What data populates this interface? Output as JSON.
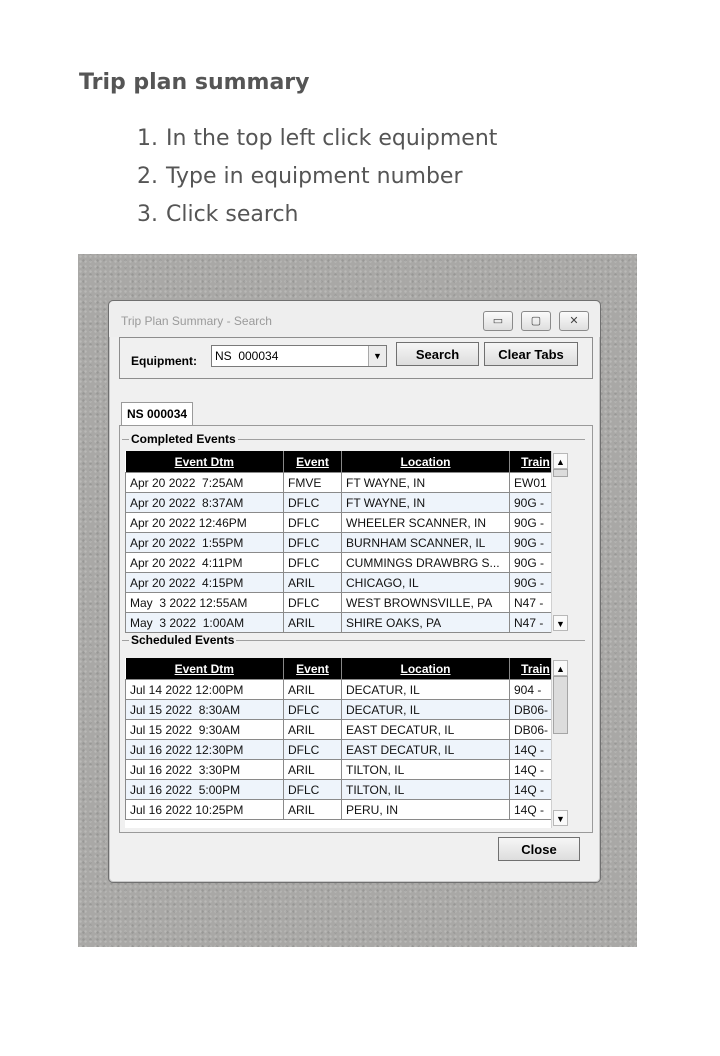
{
  "doc": {
    "heading": "Trip plan summary",
    "steps": [
      {
        "num": "1.",
        "text": "In the top left click equipment"
      },
      {
        "num": "2.",
        "text": "Type in equipment number"
      },
      {
        "num": "3.",
        "text": "Click search"
      }
    ]
  },
  "window": {
    "title": "Trip Plan Summary - Search",
    "minimize_glyph": "▭",
    "maximize_glyph": "▢",
    "close_glyph": "✕"
  },
  "search": {
    "label": "Equipment:",
    "value": "NS  000034",
    "dropdown_glyph": "▼",
    "search_label": "Search",
    "clear_tabs_label": "Clear Tabs"
  },
  "tab": {
    "label": "NS 000034"
  },
  "completed": {
    "group_label": "Completed Events",
    "columns": [
      "Event Dtm",
      "Event",
      "Location",
      "Train"
    ],
    "rows": [
      [
        "Apr 20 2022  7:25AM",
        "FMVE",
        "FT WAYNE, IN",
        "EW01"
      ],
      [
        "Apr 20 2022  8:37AM",
        "DFLC",
        "FT WAYNE, IN",
        "90G -"
      ],
      [
        "Apr 20 2022 12:46PM",
        "DFLC",
        "WHEELER SCANNER, IN",
        "90G -"
      ],
      [
        "Apr 20 2022  1:55PM",
        "DFLC",
        "BURNHAM SCANNER, IL",
        "90G -"
      ],
      [
        "Apr 20 2022  4:11PM",
        "DFLC",
        "CUMMINGS DRAWBRG S...",
        "90G -"
      ],
      [
        "Apr 20 2022  4:15PM",
        "ARIL",
        "CHICAGO, IL",
        "90G -"
      ],
      [
        "May  3 2022 12:55AM",
        "DFLC",
        "WEST BROWNSVILLE, PA",
        "N47 -"
      ],
      [
        "May  3 2022  1:00AM",
        "ARIL",
        "SHIRE OAKS, PA",
        "N47 -"
      ]
    ]
  },
  "scheduled": {
    "group_label": "Scheduled Events",
    "columns": [
      "Event Dtm",
      "Event",
      "Location",
      "Train"
    ],
    "rows": [
      [
        "Jul 14 2022 12:00PM",
        "ARIL",
        "DECATUR, IL",
        "904 -"
      ],
      [
        "Jul 15 2022  8:30AM",
        "DFLC",
        "DECATUR, IL",
        "DB06-"
      ],
      [
        "Jul 15 2022  9:30AM",
        "ARIL",
        "EAST DECATUR, IL",
        "DB06-"
      ],
      [
        "Jul 16 2022 12:30PM",
        "DFLC",
        "EAST DECATUR, IL",
        "14Q -"
      ],
      [
        "Jul 16 2022  3:30PM",
        "ARIL",
        "TILTON, IL",
        "14Q -"
      ],
      [
        "Jul 16 2022  5:00PM",
        "DFLC",
        "TILTON, IL",
        "14Q -"
      ],
      [
        "Jul 16 2022 10:25PM",
        "ARIL",
        "PERU, IN",
        "14Q -"
      ]
    ]
  },
  "scroll_glyphs": {
    "up": "▲",
    "down": "▼"
  },
  "close_button": "Close"
}
